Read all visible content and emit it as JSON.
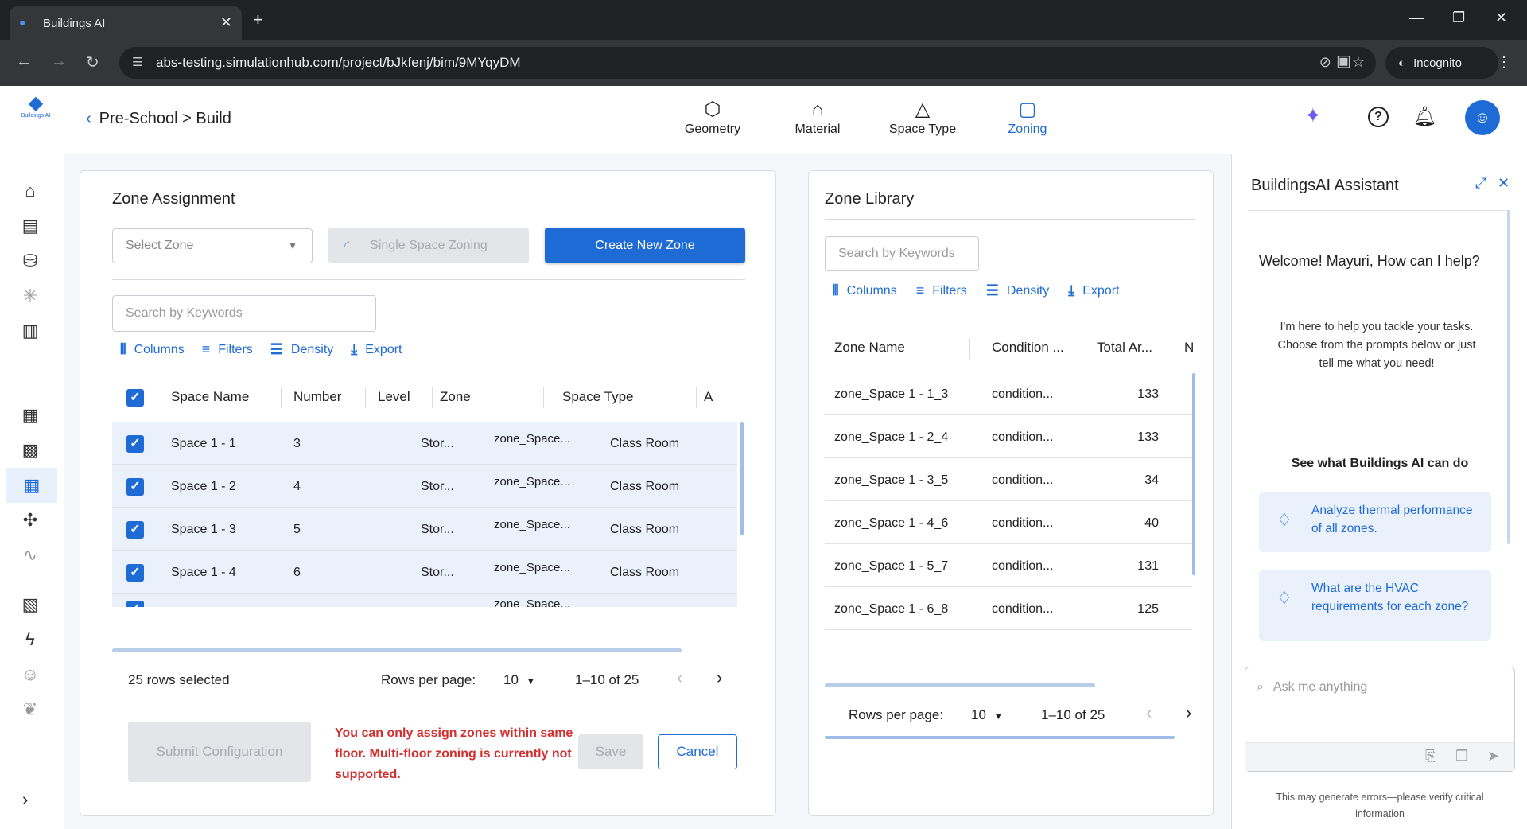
{
  "browser": {
    "tab_title": "Buildings AI",
    "url": "abs-testing.simulationhub.com/project/bJkfenj/bim/9MYqyDM",
    "profile": "Incognito"
  },
  "app": {
    "logo_text": "Buildings AI",
    "breadcrumb": "Pre-School > Build",
    "tabs": [
      {
        "label": "Geometry",
        "icon": "geometry-icon"
      },
      {
        "label": "Material",
        "icon": "material-icon"
      },
      {
        "label": "Space Type",
        "icon": "space-type-icon"
      },
      {
        "label": "Zoning",
        "icon": "zoning-icon"
      }
    ],
    "active_tab": "Zoning",
    "accent_color": "#1e6bd6"
  },
  "zone_assignment": {
    "title": "Zone Assignment",
    "select_placeholder": "Select Zone",
    "single_space_label": "Single Space Zoning",
    "create_label": "Create New Zone",
    "search_placeholder": "Search by Keywords",
    "toolbar": {
      "columns": "Columns",
      "filters": "Filters",
      "density": "Density",
      "export": "Export"
    },
    "headers": {
      "space_name": "Space Name",
      "number": "Number",
      "level": "Level",
      "zone": "Zone",
      "space_type": "Space Type",
      "extra": "A"
    },
    "rows": [
      {
        "space_name": "Space 1 - 1",
        "number": "3",
        "level": "Stor...",
        "zone": "zone_Space...",
        "space_type": "Class Room"
      },
      {
        "space_name": "Space 1 - 2",
        "number": "4",
        "level": "Stor...",
        "zone": "zone_Space...",
        "space_type": "Class Room"
      },
      {
        "space_name": "Space 1 - 3",
        "number": "5",
        "level": "Stor...",
        "zone": "zone_Space...",
        "space_type": "Class Room"
      },
      {
        "space_name": "Space 1 - 4",
        "number": "6",
        "level": "Stor...",
        "zone": "zone_Space...",
        "space_type": "Class Room"
      }
    ],
    "partial_row_zone": "zone_Space...",
    "selected_text": "25 rows selected",
    "rows_per_page_label": "Rows per page:",
    "rows_per_page": "10",
    "range": "1–10 of 25",
    "submit_label": "Submit Configuration",
    "error": "You can only assign zones within same floor. Multi-floor zoning is currently not supported.",
    "save_label": "Save",
    "cancel_label": "Cancel"
  },
  "zone_library": {
    "title": "Zone Library",
    "search_placeholder": "Search by Keywords",
    "toolbar": {
      "columns": "Columns",
      "filters": "Filters",
      "density": "Density",
      "export": "Export"
    },
    "headers": {
      "zone_name": "Zone Name",
      "condition": "Condition ...",
      "total_area": "Total Ar...",
      "num": "Nun"
    },
    "rows": [
      {
        "zone_name": "zone_Space 1 - 1_3",
        "condition": "condition...",
        "total_area": "133"
      },
      {
        "zone_name": "zone_Space 1 - 2_4",
        "condition": "condition...",
        "total_area": "133"
      },
      {
        "zone_name": "zone_Space 1 - 3_5",
        "condition": "condition...",
        "total_area": "34"
      },
      {
        "zone_name": "zone_Space 1 - 4_6",
        "condition": "condition...",
        "total_area": "40"
      },
      {
        "zone_name": "zone_Space 1 - 5_7",
        "condition": "condition...",
        "total_area": "131"
      },
      {
        "zone_name": "zone_Space 1 - 6_8",
        "condition": "condition...",
        "total_area": "125"
      }
    ],
    "rows_per_page_label": "Rows per page:",
    "rows_per_page": "10",
    "range": "1–10 of 25"
  },
  "assistant": {
    "title": "BuildingsAI Assistant",
    "welcome": "Welcome! Mayuri, How can I help?",
    "help_text": "I'm here to help you tackle your tasks. Choose from the prompts below or just tell me what you need!",
    "see_what": "See what Buildings AI can do",
    "prompts": [
      "Analyze thermal performance of all zones.",
      "What are the HVAC requirements for each zone?"
    ],
    "ask_placeholder": "Ask me anything",
    "disclaimer": "This may generate errors—please verify critical information"
  }
}
